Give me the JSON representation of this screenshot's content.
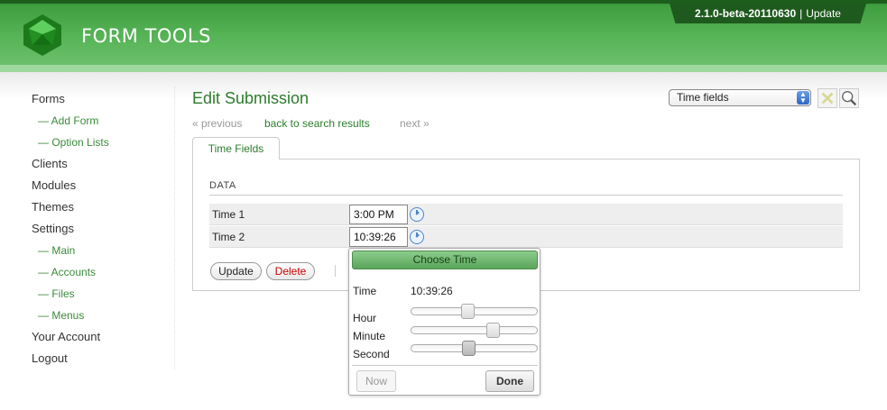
{
  "header": {
    "brand": "FORM TOOLS",
    "version": "2.1.0-beta-20110630",
    "separator": "|",
    "update_link": "Update"
  },
  "sidebar": {
    "items": [
      {
        "label": "Forms",
        "sub": false
      },
      {
        "label": "— Add Form",
        "sub": true
      },
      {
        "label": "— Option Lists",
        "sub": true
      },
      {
        "label": "Clients",
        "sub": false
      },
      {
        "label": "Modules",
        "sub": false
      },
      {
        "label": "Themes",
        "sub": false
      },
      {
        "label": "Settings",
        "sub": false
      },
      {
        "label": "— Main",
        "sub": true
      },
      {
        "label": "— Accounts",
        "sub": true
      },
      {
        "label": "— Files",
        "sub": true
      },
      {
        "label": "— Menus",
        "sub": true
      },
      {
        "label": "Your Account",
        "sub": false
      },
      {
        "label": "Logout",
        "sub": false
      }
    ]
  },
  "main": {
    "title": "Edit Submission",
    "pager": {
      "previous": "« previous",
      "back": "back to search results",
      "next": "next »"
    },
    "view_select": "Time fields",
    "tab": "Time Fields",
    "section_title": "DATA",
    "rows": [
      {
        "label": "Time 1",
        "value": "3:00 PM"
      },
      {
        "label": "Time 2",
        "value": "10:39:26"
      }
    ],
    "buttons": {
      "update": "Update",
      "delete": "Delete"
    }
  },
  "picker": {
    "header": "Choose Time",
    "time_label": "Time",
    "time_value": "10:39:26",
    "hour_label": "Hour",
    "minute_label": "Minute",
    "second_label": "Second",
    "hour": 10,
    "minute": 39,
    "second": 26,
    "now": "Now",
    "done": "Done"
  },
  "colors": {
    "brand_green": "#2c7c2c",
    "header_dark": "#1e5a1e",
    "delete_red": "#cc0000",
    "clock_blue": "#4a86d0"
  },
  "icons": [
    "gem-logo-icon",
    "select-arrow-icon",
    "clear-search-icon",
    "magnifier-icon",
    "clock-icon"
  ]
}
